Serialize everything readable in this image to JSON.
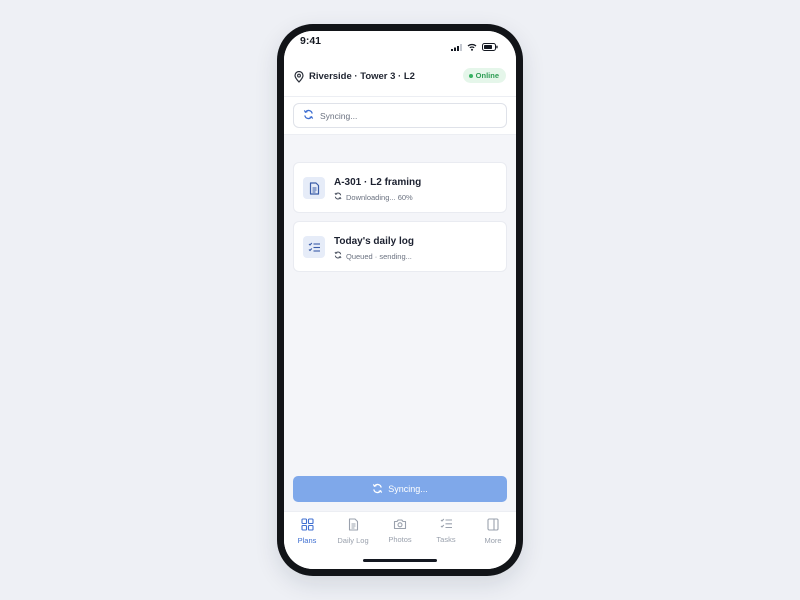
{
  "status_bar": {
    "time": "9:41"
  },
  "header": {
    "location": "Riverside · Tower 3 · L2",
    "status_badge": "Online"
  },
  "sync_banner": {
    "text": "Syncing..."
  },
  "items": [
    {
      "title": "A-301 · L2 framing",
      "status": "Downloading... 60%",
      "icon": "document-icon",
      "progress_percent": 60
    },
    {
      "title": "Today's daily log",
      "status": "Queued · sending...",
      "icon": "checklist-icon"
    }
  ],
  "primary_button": {
    "label": "Syncing..."
  },
  "tabs": [
    {
      "label": "Plans",
      "icon": "grid-icon",
      "active": true
    },
    {
      "label": "Daily Log",
      "icon": "document-icon",
      "active": false
    },
    {
      "label": "Photos",
      "icon": "camera-icon",
      "active": false
    },
    {
      "label": "Tasks",
      "icon": "checklist-icon",
      "active": false
    },
    {
      "label": "More",
      "icon": "sidebar-panel-icon",
      "active": false
    }
  ],
  "colors": {
    "accent": "#3f6fd1",
    "button_disabled": "#7fa8ea",
    "online_green": "#2f9d55",
    "background": "#f4f5f9"
  }
}
